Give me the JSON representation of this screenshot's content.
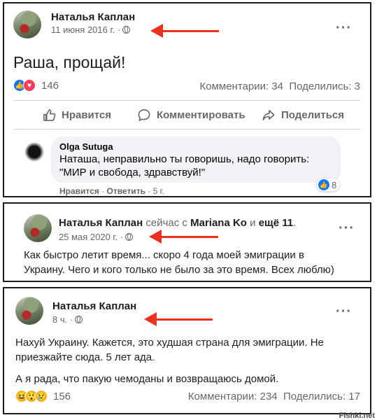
{
  "colors": {
    "accent_arrow": "#e8321f",
    "link": "#1877f2",
    "secondary_text": "#65676b"
  },
  "post1": {
    "author": "Наталья Каплан",
    "date": "11 июня 2016 г. ·",
    "text": "Раша, прощай!",
    "reaction_count": "146",
    "comments": "Комментарии: 34",
    "shares": "Поделились: 3",
    "actions": {
      "like": "Нравится",
      "comment": "Комментировать",
      "share": "Поделиться"
    },
    "comment": {
      "author": "Olga Sutuga",
      "line1": "Наташа, неправильно ты говоришь, надо говорить:",
      "line2": "\"МИР и свобода, здравствуй!\"",
      "like": "Нравится",
      "reply": "Ответить",
      "time": "5 г.",
      "reaction_count": "8"
    }
  },
  "post2": {
    "author": "Наталья Каплан",
    "with_prefix": "сейчас с",
    "with_name": "Mariana Ko",
    "and": "и",
    "others": "ещё 11",
    "dot": ".",
    "date": "25 мая 2020 г. ·",
    "line1": "Как быстро летит время... скоро 4 года моей эмиграции в",
    "line2": "Украину. Чего и кого только не было за это время. Всех люблю)"
  },
  "post3": {
    "author": "Наталья Каплан",
    "date": "8 ч. ·",
    "line1": "Нахуй Украину. Кажется, это худшая страна для эмиграции. Не",
    "line2": "приезжайте сюда. 5 лет ада.",
    "line3": "А я рада, что пакую чемоданы и возвращаюсь домой.",
    "reaction_count": "156",
    "comments": "Комментарии: 234",
    "shares": "Поделились: 17"
  },
  "watermark": "Fishki.net"
}
